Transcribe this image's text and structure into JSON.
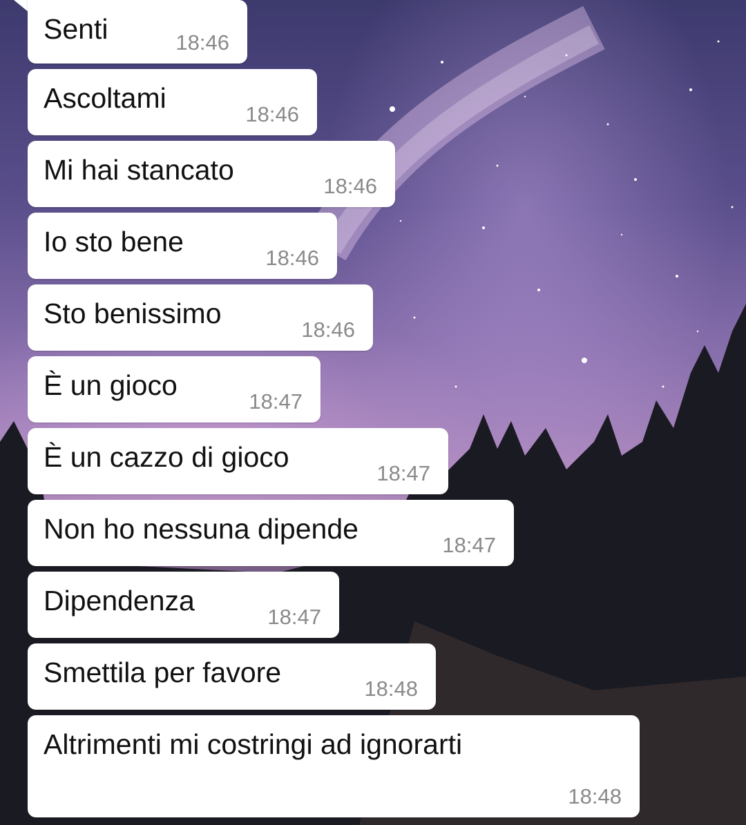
{
  "messages": [
    {
      "text": "Senti",
      "time": "18:46"
    },
    {
      "text": "Ascoltami",
      "time": "18:46"
    },
    {
      "text": "Mi hai stancato",
      "time": "18:46"
    },
    {
      "text": "Io sto bene",
      "time": "18:46"
    },
    {
      "text": "Sto benissimo",
      "time": "18:46"
    },
    {
      "text": "È un gioco",
      "time": "18:47"
    },
    {
      "text": "È un cazzo di gioco",
      "time": "18:47"
    },
    {
      "text": "Non ho nessuna dipende",
      "time": "18:47"
    },
    {
      "text": "Dipendenza",
      "time": "18:47"
    },
    {
      "text": "Smettila per favore",
      "time": "18:48"
    },
    {
      "text": "Altrimenti mi costringi ad ignorarti",
      "time": "18:48"
    }
  ],
  "colors": {
    "bubble": "#ffffff",
    "text": "#111111",
    "time": "#8a8a8a"
  }
}
